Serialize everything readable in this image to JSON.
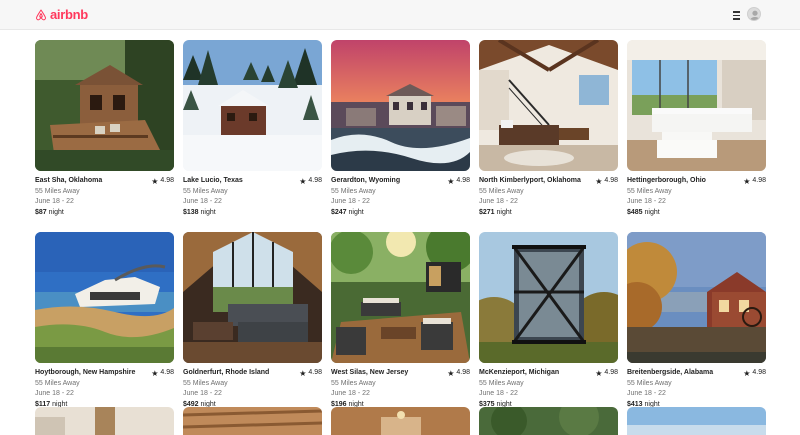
{
  "header": {
    "logo_text": "airbnb",
    "menu_icon": "hamburger-icon",
    "avatar_icon": "user-avatar-icon"
  },
  "colors": {
    "brand": "#ff385c",
    "subtext": "#717171"
  },
  "listings": [
    {
      "location": "East Sha, Oklahoma",
      "rating": "4.98",
      "distance": "55 Miles Away",
      "dates": "June 18 - 22",
      "price": "$87",
      "price_unit": "night"
    },
    {
      "location": "Lake Lucio, Texas",
      "rating": "4.98",
      "distance": "55 Miles Away",
      "dates": "June 18 - 22",
      "price": "$138",
      "price_unit": "night"
    },
    {
      "location": "Gerardton, Wyoming",
      "rating": "4.98",
      "distance": "55 Miles Away",
      "dates": "June 18 - 22",
      "price": "$247",
      "price_unit": "night"
    },
    {
      "location": "North Kimberlyport, Oklahoma",
      "rating": "4.98",
      "distance": "55 Miles Away",
      "dates": "June 18 - 22",
      "price": "$271",
      "price_unit": "night"
    },
    {
      "location": "Hettingerborough, Ohio",
      "rating": "4.98",
      "distance": "55 Miles Away",
      "dates": "June 18 - 22",
      "price": "$485",
      "price_unit": "night"
    },
    {
      "location": "Hoytborough, New Hampshire",
      "rating": "4.98",
      "distance": "55 Miles Away",
      "dates": "June 18 - 22",
      "price": "$117",
      "price_unit": "night"
    },
    {
      "location": "Goldnerfurt, Rhode Island",
      "rating": "4.98",
      "distance": "55 Miles Away",
      "dates": "June 18 - 22",
      "price": "$492",
      "price_unit": "night"
    },
    {
      "location": "West Silas, New Jersey",
      "rating": "4.98",
      "distance": "55 Miles Away",
      "dates": "June 18 - 22",
      "price": "$196",
      "price_unit": "night"
    },
    {
      "location": "McKenzieport, Michigan",
      "rating": "4.98",
      "distance": "55 Miles Away",
      "dates": "June 18 - 22",
      "price": "$375",
      "price_unit": "night"
    },
    {
      "location": "Breitenbergside, Alabama",
      "rating": "4.98",
      "distance": "55 Miles Away",
      "dates": "June 18 - 22",
      "price": "$413",
      "price_unit": "night"
    }
  ]
}
